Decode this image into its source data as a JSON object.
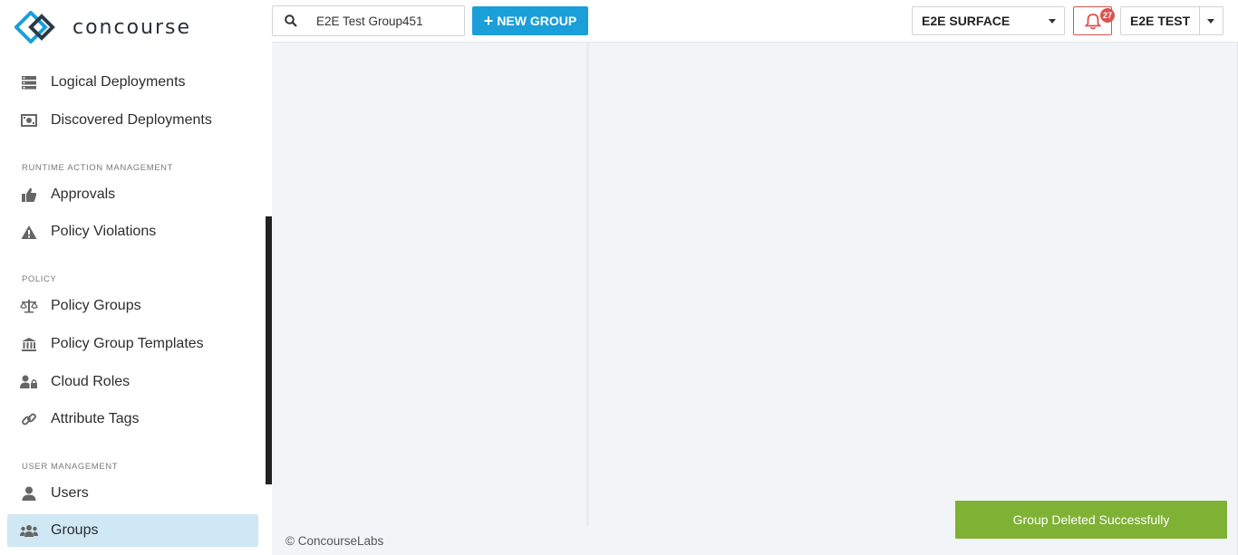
{
  "brand": {
    "name": "concourse",
    "accent": "#1a9fd8"
  },
  "sidebar": {
    "items_top": [
      {
        "label": "Logical Deployments",
        "icon": "server-icon"
      },
      {
        "label": "Discovered Deployments",
        "icon": "discovered-icon"
      }
    ],
    "sections": [
      {
        "header": "RUNTIME ACTION MANAGEMENT",
        "items": [
          {
            "label": "Approvals",
            "icon": "thumbs-up-icon"
          },
          {
            "label": "Policy Violations",
            "icon": "warning-icon"
          }
        ]
      },
      {
        "header": "POLICY",
        "items": [
          {
            "label": "Policy Groups",
            "icon": "balance-scale-icon"
          },
          {
            "label": "Policy Group Templates",
            "icon": "bank-icon"
          },
          {
            "label": "Cloud Roles",
            "icon": "user-lock-icon"
          },
          {
            "label": "Attribute Tags",
            "icon": "link-icon"
          }
        ]
      },
      {
        "header": "USER MANAGEMENT",
        "items": [
          {
            "label": "Users",
            "icon": "user-icon"
          },
          {
            "label": "Groups",
            "icon": "users-icon",
            "active": true
          }
        ]
      }
    ]
  },
  "topbar": {
    "search_value": "E2E Test Group451",
    "new_group_label": "NEW GROUP",
    "surface_label": "E2E SURFACE",
    "notification_count": "27",
    "user_label": "E2E TEST"
  },
  "footer": {
    "text": "© ConcourseLabs"
  },
  "toast": {
    "text": "Group Deleted Successfully",
    "color": "#7fb135"
  }
}
